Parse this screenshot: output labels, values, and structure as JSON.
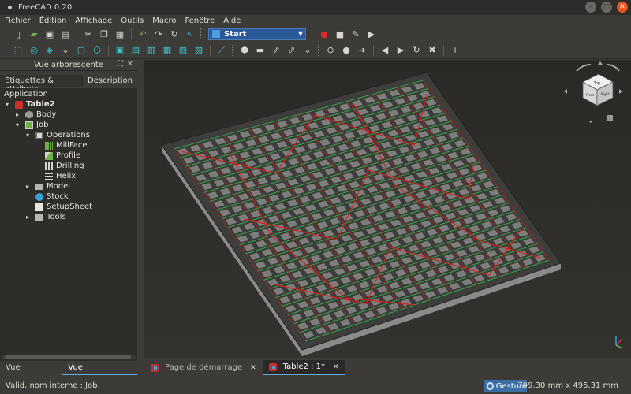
{
  "window": {
    "title": "FreeCAD 0.20"
  },
  "menu": [
    "Fichier",
    "Édition",
    "Affichage",
    "Outils",
    "Macro",
    "Fenêtre",
    "Aide"
  ],
  "toolbar": {
    "workbench": "Start"
  },
  "left_panel": {
    "title": "Vue arborescente",
    "tabs": [
      "Étiquettes & attributs",
      "Description"
    ],
    "tree": [
      {
        "label": "Application",
        "depth": 0
      },
      {
        "label": "Table2",
        "depth": 1,
        "expander": "▾",
        "icon": "document-icon"
      },
      {
        "label": "Body",
        "depth": 2,
        "expander": "▸",
        "icon": "body-icon"
      },
      {
        "label": "Job",
        "depth": 2,
        "expander": "▾",
        "icon": "job-icon"
      },
      {
        "label": "Operations",
        "depth": 3,
        "expander": "▾",
        "icon": "operations-icon"
      },
      {
        "label": "MillFace",
        "depth": 4,
        "icon": "millface-icon"
      },
      {
        "label": "Profile",
        "depth": 4,
        "icon": "profile-icon"
      },
      {
        "label": "Drilling",
        "depth": 4,
        "icon": "drilling-icon"
      },
      {
        "label": "Helix",
        "depth": 4,
        "icon": "helix-icon"
      },
      {
        "label": "Model",
        "depth": 3,
        "expander": "▸",
        "icon": "folder-icon"
      },
      {
        "label": "Stock",
        "depth": 3,
        "icon": "stock-icon"
      },
      {
        "label": "SetupSheet",
        "depth": 3,
        "icon": "setupsheet-icon"
      },
      {
        "label": "Tools",
        "depth": 3,
        "expander": "▸",
        "icon": "folder-icon"
      }
    ],
    "bottom_tabs": [
      "Vue combinée",
      "Vue arborescente"
    ]
  },
  "doc_tabs": [
    {
      "label": "Page de démarrage",
      "close": "✕"
    },
    {
      "label": "Table2 : 1*",
      "close": "✕"
    }
  ],
  "status": {
    "message": "Valid, nom interne : Job",
    "nav_style": "Gesture",
    "dimensions": "799,30 mm x 495,31 mm"
  },
  "navcube": {
    "top": "Top",
    "front": "Front",
    "right": "Right"
  }
}
